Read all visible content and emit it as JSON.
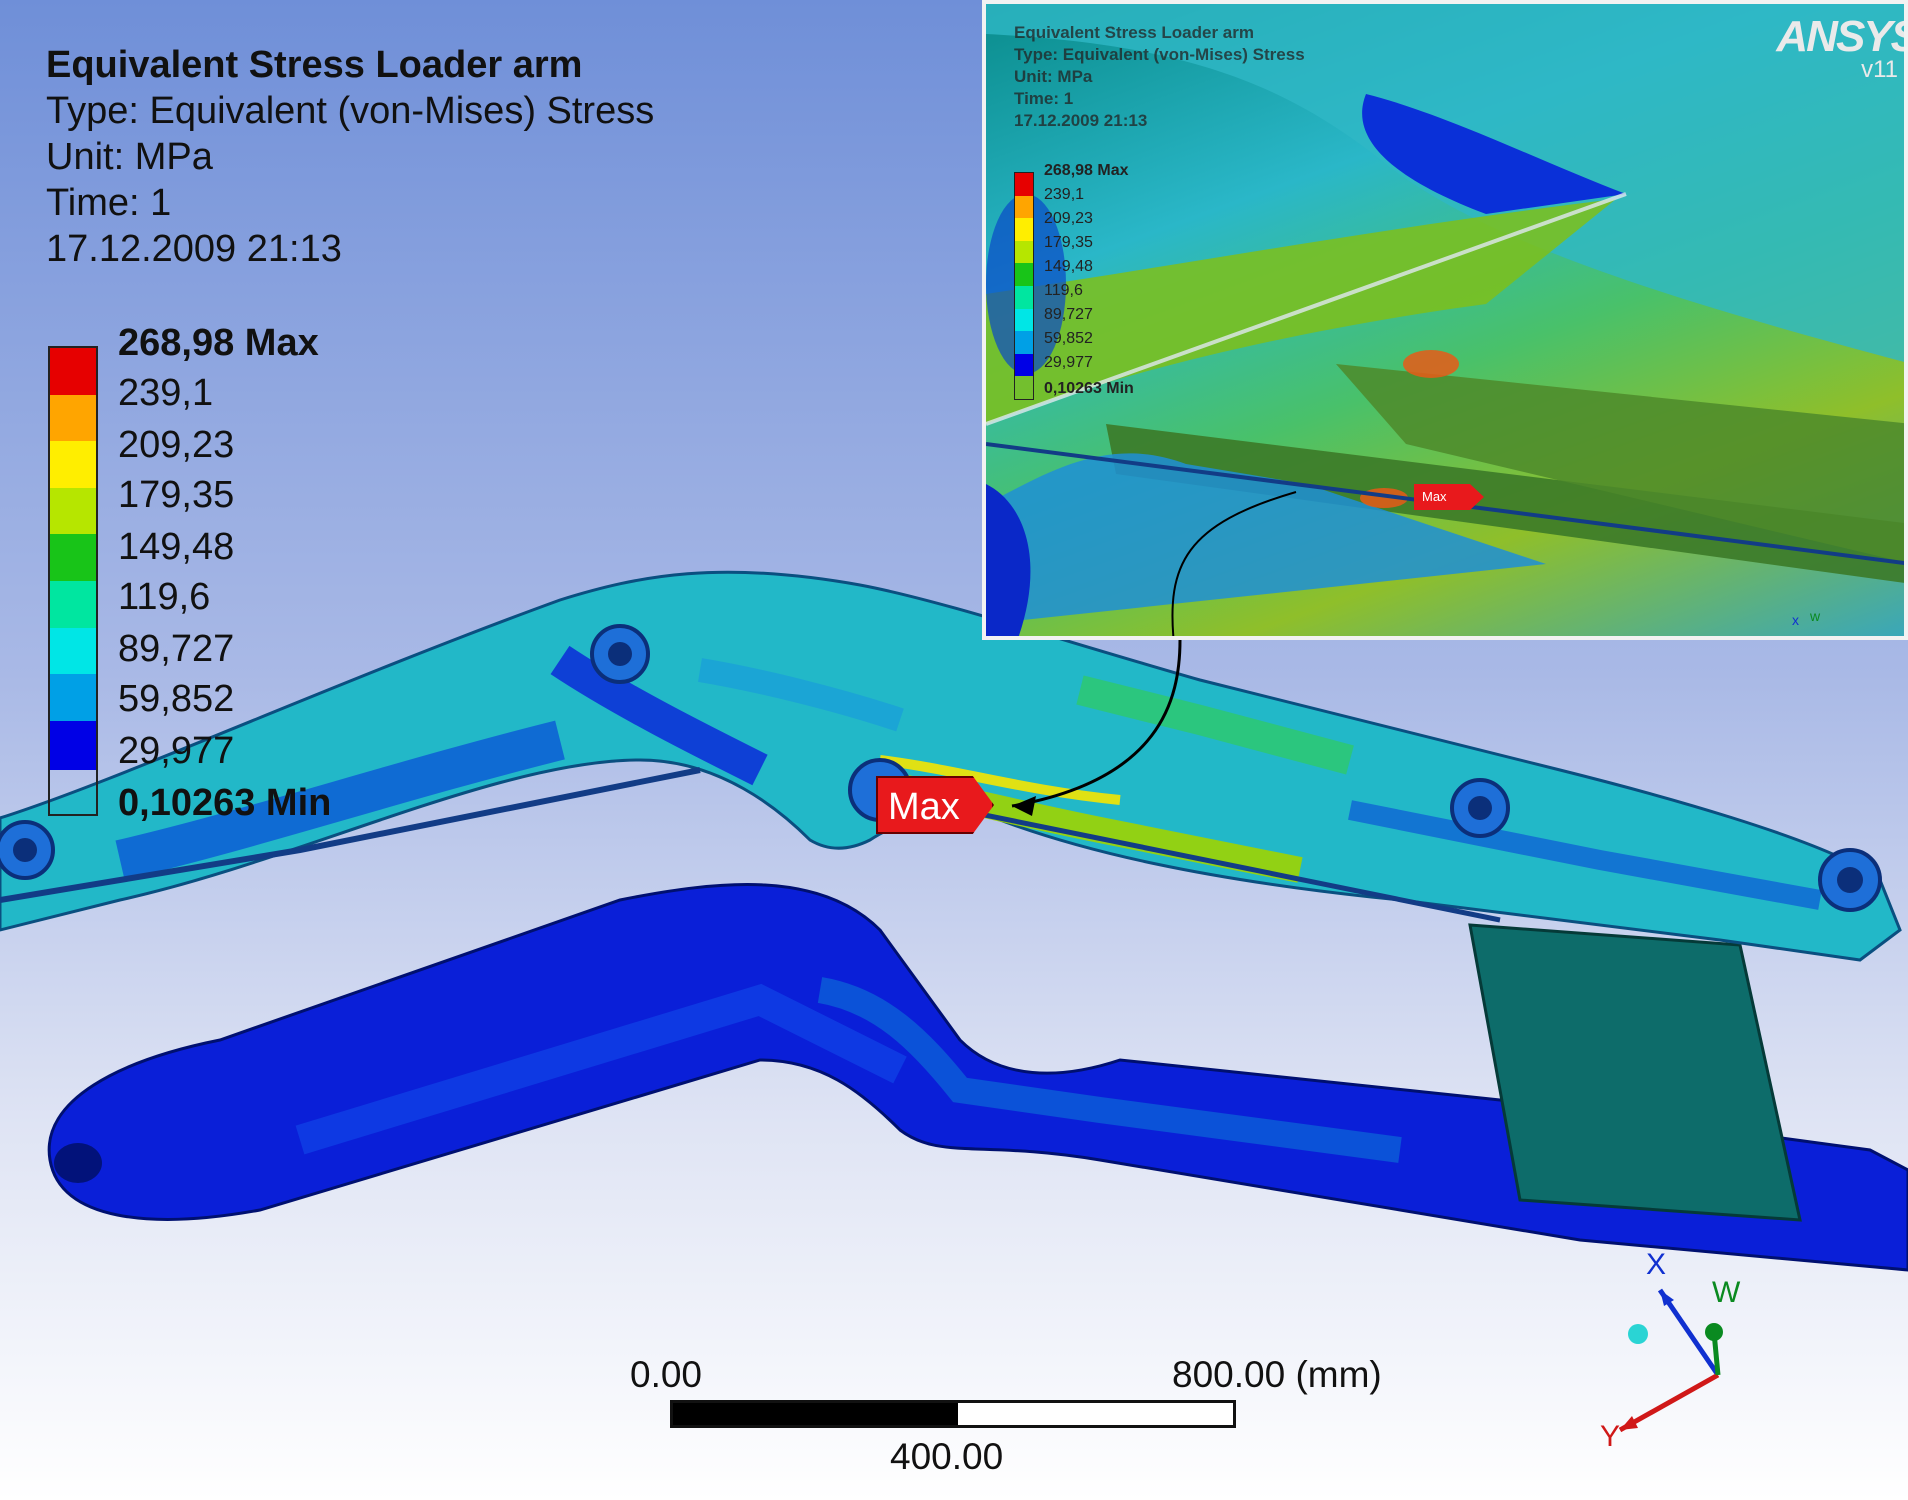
{
  "result_info": {
    "title": "Equivalent Stress Loader arm",
    "type": "Type: Equivalent (von-Mises) Stress",
    "unit": "Unit: MPa",
    "time": "Time: 1",
    "date": "17.12.2009 21:13"
  },
  "legend": {
    "max_label": "268,98 Max",
    "min_label": "0,10263 Min",
    "values": [
      "239,1",
      "209,23",
      "179,35",
      "149,48",
      "119,6",
      "89,727",
      "59,852",
      "29,977"
    ],
    "colors": [
      "#e60000",
      "#ffa500",
      "#ffee00",
      "#b6e600",
      "#18c418",
      "#00e6a0",
      "#00e6e6",
      "#00a0e6",
      "#0000e6"
    ]
  },
  "probe": {
    "max_tag": "Max"
  },
  "inset": {
    "logo": "ANSYS",
    "version": "v11",
    "max_tag": "Max",
    "triad_labels": [
      "x",
      "w"
    ]
  },
  "scale_bar": {
    "left": "0.00",
    "middle": "400.00",
    "right": "800.00 (mm)"
  },
  "triad": {
    "x_label": "X",
    "y_label": "Y",
    "w_label": "W"
  }
}
